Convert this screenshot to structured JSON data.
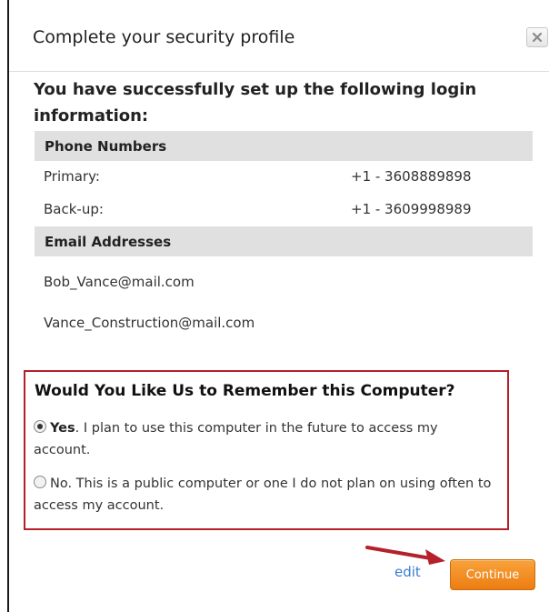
{
  "dialog": {
    "title": "Complete your security profile"
  },
  "summary": {
    "heading": "You have successfully set up the following login information:"
  },
  "phone_section": {
    "title": "Phone Numbers",
    "rows": [
      {
        "label": "Primary:",
        "value": "+1 - 3608889898"
      },
      {
        "label": "Back-up:",
        "value": "+1 - 3609998989"
      }
    ]
  },
  "email_section": {
    "title": "Email Addresses",
    "emails": [
      "Bob_Vance@mail.com",
      "Vance_Construction@mail.com"
    ]
  },
  "remember": {
    "title": "Would You Like Us to Remember this Computer?",
    "yes_strong": "Yes",
    "yes_text": ". I plan to use this computer in the future to access my account.",
    "no_text": "No. This is a public computer or one I do not plan on using often to access my account.",
    "selected": "yes"
  },
  "actions": {
    "edit_label": "edit",
    "continue_label": "Continue"
  },
  "colors": {
    "highlight_border": "#b5202b",
    "continue_button": "#ec7d12",
    "link": "#3a7bd5",
    "section_bar": "#e0e0e0"
  }
}
